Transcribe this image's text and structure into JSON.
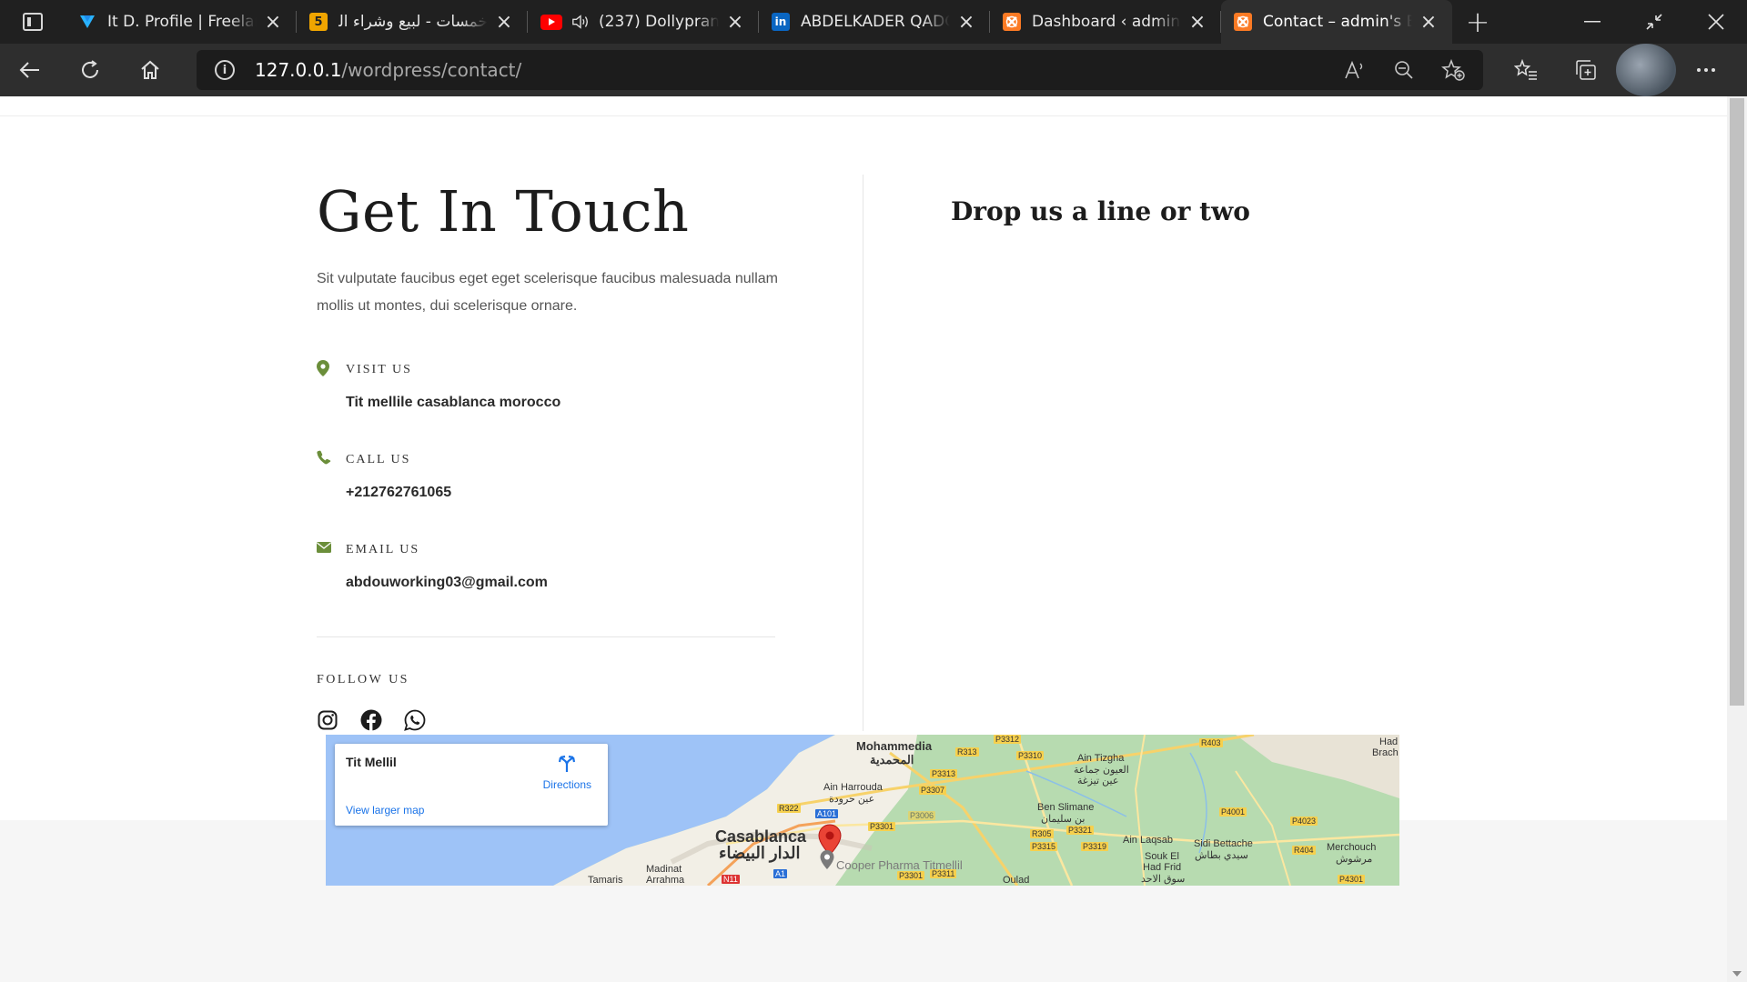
{
  "browser": {
    "tabs": [
      {
        "title": "It D. Profile | Freelancer",
        "favicon": "freelancer-icon",
        "color": "#1f8ceb"
      },
      {
        "title": "خمسات - لبيع وشراء الخدمات",
        "favicon": "khamsat-icon",
        "color": "#f0a500"
      },
      {
        "title": "(237) Dollypran",
        "favicon": "youtube-icon",
        "color": "#ff0000"
      },
      {
        "title": "ABDELKADER QADOUR",
        "favicon": "linkedin-icon",
        "color": "#0a66c2"
      },
      {
        "title": "Dashboard ‹ admin's Blog",
        "favicon": "xampp-icon",
        "color": "#fb7a24"
      },
      {
        "title": "Contact – admin's Blog",
        "favicon": "xampp-icon",
        "color": "#fb7a24"
      }
    ],
    "url_host": "127.0.0.1",
    "url_path": "/wordpress/contact/"
  },
  "page": {
    "heading": "Get In Touch",
    "intro": "Sit vulputate faucibus eget eget scelerisque faucibus malesuada nullam mollis ut montes, dui scelerisque ornare.",
    "visit": {
      "label": "VISIT US",
      "value": "Tit mellile casablanca morocco"
    },
    "call": {
      "label": "CALL US",
      "value": "+212762761065"
    },
    "email": {
      "label": "EMAIL US",
      "value": "abdouworking03@gmail.com"
    },
    "follow_label": "FOLLOW US",
    "form_heading": "Drop us a line or two",
    "accent_color": "#6b8e3a"
  },
  "map": {
    "place": "Tit Mellil",
    "directions": "Directions",
    "larger": "View larger map",
    "labels": {
      "mohammedia": "Mohammedia",
      "mohammedia_ar": "المحمدية",
      "casablanca": "Casablanca",
      "casablanca_ar": "الدار البيضاء",
      "ain_harrouda": "Ain Harrouda",
      "ain_harrouda_ar": "عين حرودة",
      "ben_slimane": "Ben Slimane",
      "ben_slimane_ar": "بن سليمان",
      "ain_tizgha": "Ain Tizgha",
      "ain_tizgha_ar": "العيون جماعة",
      "ain_tizgha_ar2": "عين تيزغة",
      "ain_laqsab": "Ain Laqsab",
      "sidi_bettache": "Sidi Bettache",
      "sidi_bettache_ar": "سيدي بطاش",
      "souk_el_had": "Souk El",
      "had_frid": "Had Frid",
      "had_frid_ar": "سوق الاحد",
      "merchouch": "Merchouch",
      "merchouch_ar": "مرشوش",
      "madinat": "Madinat",
      "arrahma": "Arrahma",
      "tamaris": "Tamaris",
      "oulad": "Oulad",
      "had_brach": "Had",
      "brach": "Brach",
      "cooper": "Cooper Pharma Titmellil"
    },
    "routes": [
      "P3312",
      "R313",
      "P3310",
      "R403",
      "P3313",
      "P3307",
      "R322",
      "A101",
      "P3301",
      "P3006",
      "R305",
      "P3321",
      "P3315",
      "P3319",
      "P4001",
      "P4023",
      "R404",
      "P3301",
      "P3311",
      "P4301",
      "A1",
      "N11"
    ]
  }
}
